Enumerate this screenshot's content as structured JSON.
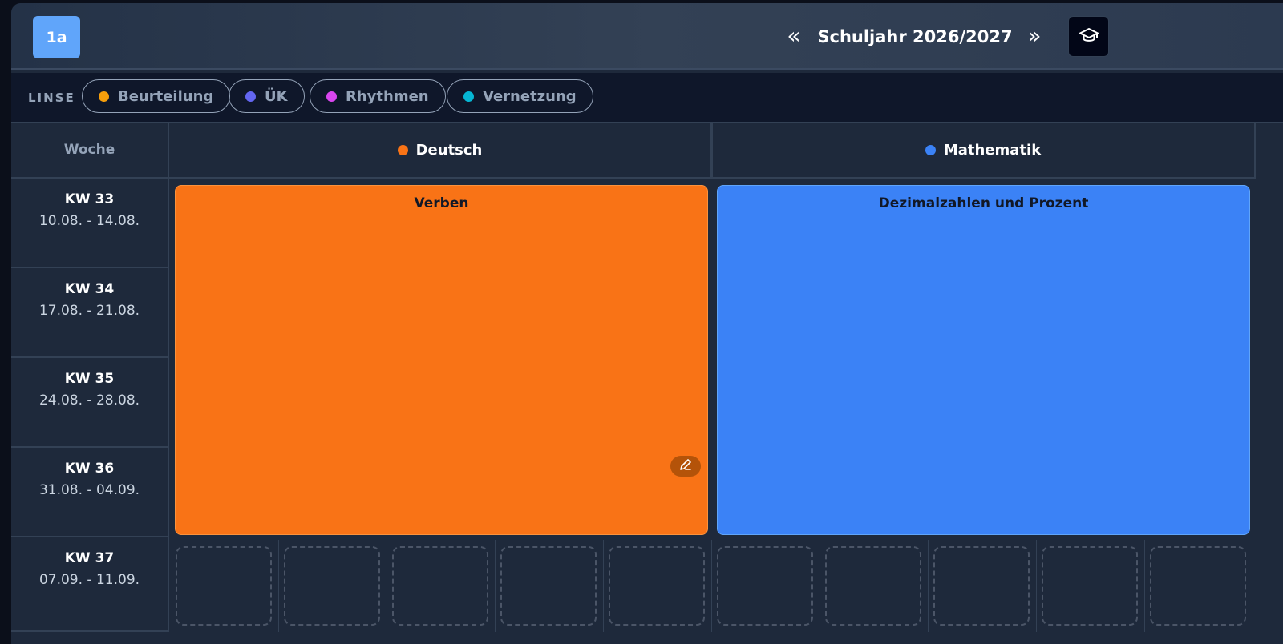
{
  "header": {
    "class_label": "1a",
    "prev_symbol": "«",
    "next_symbol": "»",
    "school_year": "Schuljahr 2026/2027",
    "cap_icon": "graduation-cap-icon"
  },
  "lens": {
    "label": "LINSE",
    "chips": [
      {
        "label": "Beurteilung",
        "color": "#f59e0b"
      },
      {
        "label": "ÜK",
        "color": "#6366f1"
      },
      {
        "label": "Rhythmen",
        "color": "#d946ef"
      },
      {
        "label": "Vernetzung",
        "color": "#06b6d4"
      }
    ]
  },
  "grid": {
    "week_header": "Woche",
    "subjects": [
      {
        "name": "Deutsch",
        "color": "#f97316"
      },
      {
        "name": "Mathematik",
        "color": "#3b82f6"
      }
    ],
    "weeks": [
      {
        "kw": "KW 33",
        "range": "10.08. - 14.08."
      },
      {
        "kw": "KW 34",
        "range": "17.08. - 21.08."
      },
      {
        "kw": "KW 35",
        "range": "24.08. - 28.08."
      },
      {
        "kw": "KW 36",
        "range": "31.08. - 04.09."
      },
      {
        "kw": "KW 37",
        "range": "07.09. - 11.09."
      }
    ],
    "topics": [
      {
        "title": "Verben",
        "color": "#f97316"
      },
      {
        "title": "Dezimalzahlen und Prozent",
        "color": "#3b82f6"
      }
    ]
  }
}
